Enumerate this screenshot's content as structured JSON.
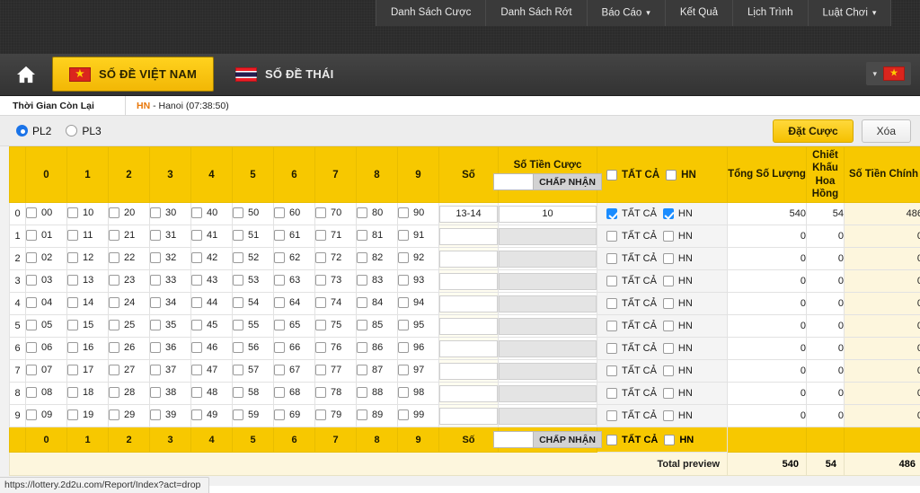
{
  "topnav": {
    "items": [
      {
        "label": "Danh Sách Cược",
        "caret": false
      },
      {
        "label": "Danh Sách Rớt",
        "caret": false
      },
      {
        "label": "Báo Cáo",
        "caret": true
      },
      {
        "label": "Kết Quả",
        "caret": false
      },
      {
        "label": "Lịch Trình",
        "caret": false
      },
      {
        "label": "Luật Chơi",
        "caret": true
      }
    ],
    "cursor_mark": "⌄"
  },
  "tabbar": {
    "home_icon": "home-icon",
    "tabs": [
      {
        "label": "SỐ ĐỀ VIỆT NAM",
        "flag": "vn",
        "active": true
      },
      {
        "label": "SỐ ĐỀ THÁI",
        "flag": "th",
        "active": false
      }
    ],
    "lang": {
      "flag": "vn",
      "caret": "▾"
    }
  },
  "info": {
    "time_label": "Thời Gian Còn Lại",
    "region_code": "HN",
    "region_text": "- Hanoi (07:38:50)"
  },
  "controls": {
    "radios": [
      {
        "label": "PL2",
        "selected": true
      },
      {
        "label": "PL3",
        "selected": false
      }
    ],
    "bet_button": "Đặt Cược",
    "clear_button": "Xóa"
  },
  "table": {
    "digit_headers": [
      "0",
      "1",
      "2",
      "3",
      "4",
      "5",
      "6",
      "7",
      "8",
      "9"
    ],
    "header_so": "Số",
    "header_tien": "Số Tiền Cược",
    "header_accept": "CHẤP NHẬN",
    "header_tien_value": "",
    "header_tien_placeholder": "",
    "header_all": "TẤT CẢ",
    "header_hn": "HN",
    "header_tong": "Tổng Số Lượng",
    "header_ck": "Chiết Khấu Hoa Hồng",
    "header_chinh": "Số Tiền Chính",
    "rows": [
      {
        "idx": "0",
        "numbers": [
          "00",
          "10",
          "20",
          "30",
          "40",
          "50",
          "60",
          "70",
          "80",
          "90"
        ],
        "checked": [
          false,
          false,
          false,
          false,
          false,
          false,
          false,
          false,
          false,
          false
        ],
        "so": "13-14",
        "tien": "10",
        "tien_enabled": true,
        "all_checked": true,
        "hn_checked": true,
        "tong": "540",
        "ck": "54",
        "chinh": "486"
      },
      {
        "idx": "1",
        "numbers": [
          "01",
          "11",
          "21",
          "31",
          "41",
          "51",
          "61",
          "71",
          "81",
          "91"
        ],
        "checked": [
          false,
          false,
          false,
          false,
          false,
          false,
          false,
          false,
          false,
          false
        ],
        "so": "",
        "tien": "",
        "tien_enabled": false,
        "all_checked": false,
        "hn_checked": false,
        "tong": "0",
        "ck": "0",
        "chinh": "0"
      },
      {
        "idx": "2",
        "numbers": [
          "02",
          "12",
          "22",
          "32",
          "42",
          "52",
          "62",
          "72",
          "82",
          "92"
        ],
        "checked": [
          false,
          false,
          false,
          false,
          false,
          false,
          false,
          false,
          false,
          false
        ],
        "so": "",
        "tien": "",
        "tien_enabled": false,
        "all_checked": false,
        "hn_checked": false,
        "tong": "0",
        "ck": "0",
        "chinh": "0"
      },
      {
        "idx": "3",
        "numbers": [
          "03",
          "13",
          "23",
          "33",
          "43",
          "53",
          "63",
          "73",
          "83",
          "93"
        ],
        "checked": [
          false,
          false,
          false,
          false,
          false,
          false,
          false,
          false,
          false,
          false
        ],
        "so": "",
        "tien": "",
        "tien_enabled": false,
        "all_checked": false,
        "hn_checked": false,
        "tong": "0",
        "ck": "0",
        "chinh": "0"
      },
      {
        "idx": "4",
        "numbers": [
          "04",
          "14",
          "24",
          "34",
          "44",
          "54",
          "64",
          "74",
          "84",
          "94"
        ],
        "checked": [
          false,
          false,
          false,
          false,
          false,
          false,
          false,
          false,
          false,
          false
        ],
        "so": "",
        "tien": "",
        "tien_enabled": false,
        "all_checked": false,
        "hn_checked": false,
        "tong": "0",
        "ck": "0",
        "chinh": "0"
      },
      {
        "idx": "5",
        "numbers": [
          "05",
          "15",
          "25",
          "35",
          "45",
          "55",
          "65",
          "75",
          "85",
          "95"
        ],
        "checked": [
          false,
          false,
          false,
          false,
          false,
          false,
          false,
          false,
          false,
          false
        ],
        "so": "",
        "tien": "",
        "tien_enabled": false,
        "all_checked": false,
        "hn_checked": false,
        "tong": "0",
        "ck": "0",
        "chinh": "0"
      },
      {
        "idx": "6",
        "numbers": [
          "06",
          "16",
          "26",
          "36",
          "46",
          "56",
          "66",
          "76",
          "86",
          "96"
        ],
        "checked": [
          false,
          false,
          false,
          false,
          false,
          false,
          false,
          false,
          false,
          false
        ],
        "so": "",
        "tien": "",
        "tien_enabled": false,
        "all_checked": false,
        "hn_checked": false,
        "tong": "0",
        "ck": "0",
        "chinh": "0"
      },
      {
        "idx": "7",
        "numbers": [
          "07",
          "17",
          "27",
          "37",
          "47",
          "57",
          "67",
          "77",
          "87",
          "97"
        ],
        "checked": [
          false,
          false,
          false,
          false,
          false,
          false,
          false,
          false,
          false,
          false
        ],
        "so": "",
        "tien": "",
        "tien_enabled": false,
        "all_checked": false,
        "hn_checked": false,
        "tong": "0",
        "ck": "0",
        "chinh": "0"
      },
      {
        "idx": "8",
        "numbers": [
          "08",
          "18",
          "28",
          "38",
          "48",
          "58",
          "68",
          "78",
          "88",
          "98"
        ],
        "checked": [
          false,
          false,
          false,
          false,
          false,
          false,
          false,
          false,
          false,
          false
        ],
        "so": "",
        "tien": "",
        "tien_enabled": false,
        "all_checked": false,
        "hn_checked": false,
        "tong": "0",
        "ck": "0",
        "chinh": "0"
      },
      {
        "idx": "9",
        "numbers": [
          "09",
          "19",
          "29",
          "39",
          "49",
          "59",
          "69",
          "79",
          "89",
          "99"
        ],
        "checked": [
          false,
          false,
          false,
          false,
          false,
          false,
          false,
          false,
          false,
          false
        ],
        "so": "",
        "tien": "",
        "tien_enabled": false,
        "all_checked": false,
        "hn_checked": false,
        "tong": "0",
        "ck": "0",
        "chinh": "0"
      }
    ],
    "footer": {
      "tien_value": "",
      "accept": "CHẤP NHẬN",
      "all": "TẤT CẢ",
      "hn": "HN"
    },
    "total": {
      "label": "Total preview",
      "tong": "540",
      "ck": "54",
      "chinh": "486"
    }
  },
  "statusbar": {
    "url": "https://lottery.2d2u.com/Report/Index?act=drop"
  },
  "colors": {
    "accent_yellow": "#f7c800",
    "dark_nav": "#2b2b2b",
    "highlight_orange": "#e8780a",
    "checkbox_blue": "#1a8cff"
  }
}
